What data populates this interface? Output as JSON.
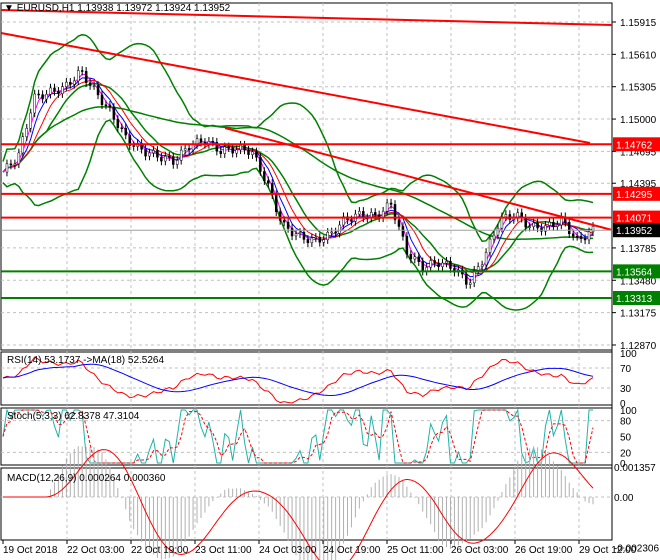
{
  "header": {
    "symbol": "EURUSD,H1",
    "ohlc": "1.13938 1.13972 1.13924 1.13952"
  },
  "price_axis": [
    "1.15915",
    "1.15610",
    "1.15305",
    "1.15000",
    "1.14695",
    "1.14395",
    "1.13785",
    "1.13480",
    "1.13175",
    "1.12870"
  ],
  "levels": [
    {
      "label": "1.14762",
      "color": "#ff0000"
    },
    {
      "label": "1.14295",
      "color": "#ff0000"
    },
    {
      "label": "1.14071",
      "color": "#ff0000"
    },
    {
      "label": "1.13564",
      "color": "#008000"
    },
    {
      "label": "1.13313",
      "color": "#008000"
    }
  ],
  "current_price": "1.13952",
  "rsi": {
    "label": "RSI(14) 53.1737  ->MA(18) 52.5264",
    "ticks": [
      "100",
      "70",
      "30",
      "0"
    ]
  },
  "stoch": {
    "label": "Stoch(5,3,3) 62.8378 47.3104",
    "ticks": [
      "100",
      "80",
      "50",
      "20",
      "0"
    ]
  },
  "macd": {
    "label": "MACD(12,26,9) 0.000264 0.000360",
    "ticks": [
      "0.001357",
      "0.00",
      "-0.002306"
    ]
  },
  "time_axis": [
    "19 Oct 2018",
    "22 Oct 03:00",
    "22 Oct 19:00",
    "23 Oct 11:00",
    "24 Oct 03:00",
    "24 Oct 19:00",
    "25 Oct 11:00",
    "26 Oct 03:00",
    "26 Oct 19:00",
    "29 Oct 12:00"
  ],
  "chart_data": {
    "type": "line",
    "title": "EURUSD,H1",
    "closes": [
      1.145,
      1.1465,
      1.152,
      1.1525,
      1.153,
      1.1545,
      1.1525,
      1.1505,
      1.148,
      1.147,
      1.1465,
      1.146,
      1.1475,
      1.148,
      1.147,
      1.1472,
      1.147,
      1.144,
      1.14,
      1.139,
      1.1385,
      1.139,
      1.1405,
      1.141,
      1.1408,
      1.142,
      1.1375,
      1.136,
      1.1365,
      1.136,
      1.1345,
      1.137,
      1.1405,
      1.141,
      1.1398,
      1.1398,
      1.1405,
      1.1385,
      1.13952
    ],
    "ylim": [
      1.1287,
      1.1592
    ]
  }
}
